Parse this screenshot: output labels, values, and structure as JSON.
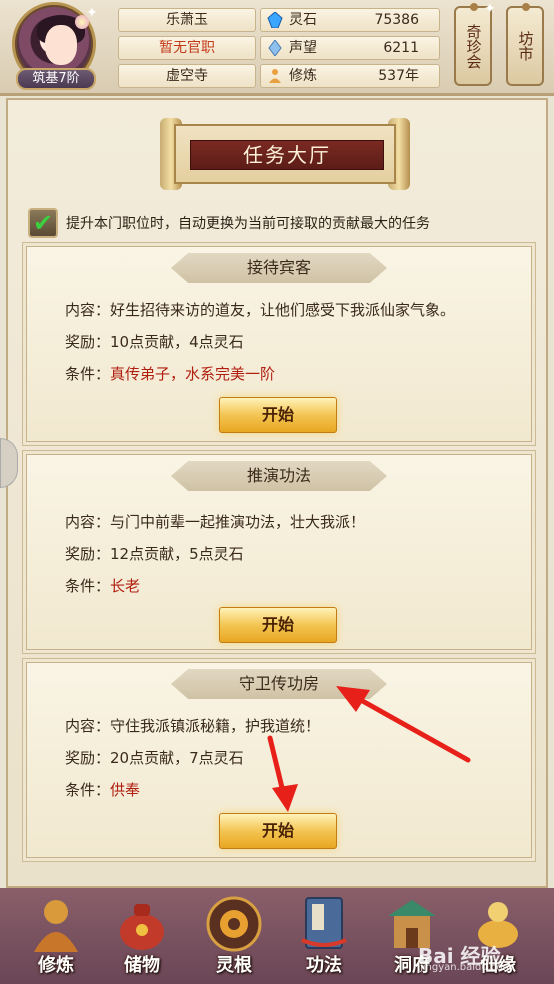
{
  "player": {
    "name": "乐萧玉",
    "official_rank": "暂无官职",
    "sect": "虚空寺",
    "realm": "筑基7阶"
  },
  "stats": [
    {
      "label": "灵石",
      "value": "75386",
      "icon": "spirit-stone-icon",
      "color": "#3aa6ff"
    },
    {
      "label": "声望",
      "value": "6211",
      "icon": "reputation-crystal-icon",
      "color": "#6fa8e8"
    },
    {
      "label": "修炼",
      "value": "537年",
      "icon": "meditation-icon",
      "color": "#e8a040"
    }
  ],
  "side_buttons": {
    "treasure": "奇珍会",
    "market": "坊市"
  },
  "page_title": "任务大厅",
  "auto_option": {
    "checked": true,
    "text": "提升本门职位时，自动更换为当前可接取的贡献最大的任务"
  },
  "tasks": [
    {
      "title": "接待宾客",
      "content_label": "内容：",
      "content": "好生招待来访的道友，让他们感受下我派仙家气象。",
      "reward_label": "奖励：",
      "reward": "10点贡献，4点灵石",
      "condition_label": "条件：",
      "condition": "真传弟子，水系完美一阶",
      "start_label": "开始"
    },
    {
      "title": "推演功法",
      "content_label": "内容：",
      "content": "与门中前辈一起推演功法，壮大我派！",
      "reward_label": "奖励：",
      "reward": "12点贡献，5点灵石",
      "condition_label": "条件：",
      "condition": "长老",
      "start_label": "开始"
    },
    {
      "title": "守卫传功房",
      "content_label": "内容：",
      "content": "守住我派镇派秘籍，护我道统！",
      "reward_label": "奖励：",
      "reward": "20点贡献，7点灵石",
      "condition_label": "条件：",
      "condition": "供奉",
      "start_label": "开始"
    }
  ],
  "bottom_nav": [
    {
      "label": "修炼",
      "icon": "cultivation-monk-icon"
    },
    {
      "label": "储物",
      "icon": "storage-bag-icon"
    },
    {
      "label": "灵根",
      "icon": "spirit-root-icon"
    },
    {
      "label": "功法",
      "icon": "technique-book-icon"
    },
    {
      "label": "洞府",
      "icon": "cave-dwelling-icon"
    },
    {
      "label": "仙缘",
      "icon": "immortal-fate-icon"
    }
  ],
  "watermark": {
    "text": "Bai 经验",
    "sub": "jingyan.baidu.com"
  }
}
